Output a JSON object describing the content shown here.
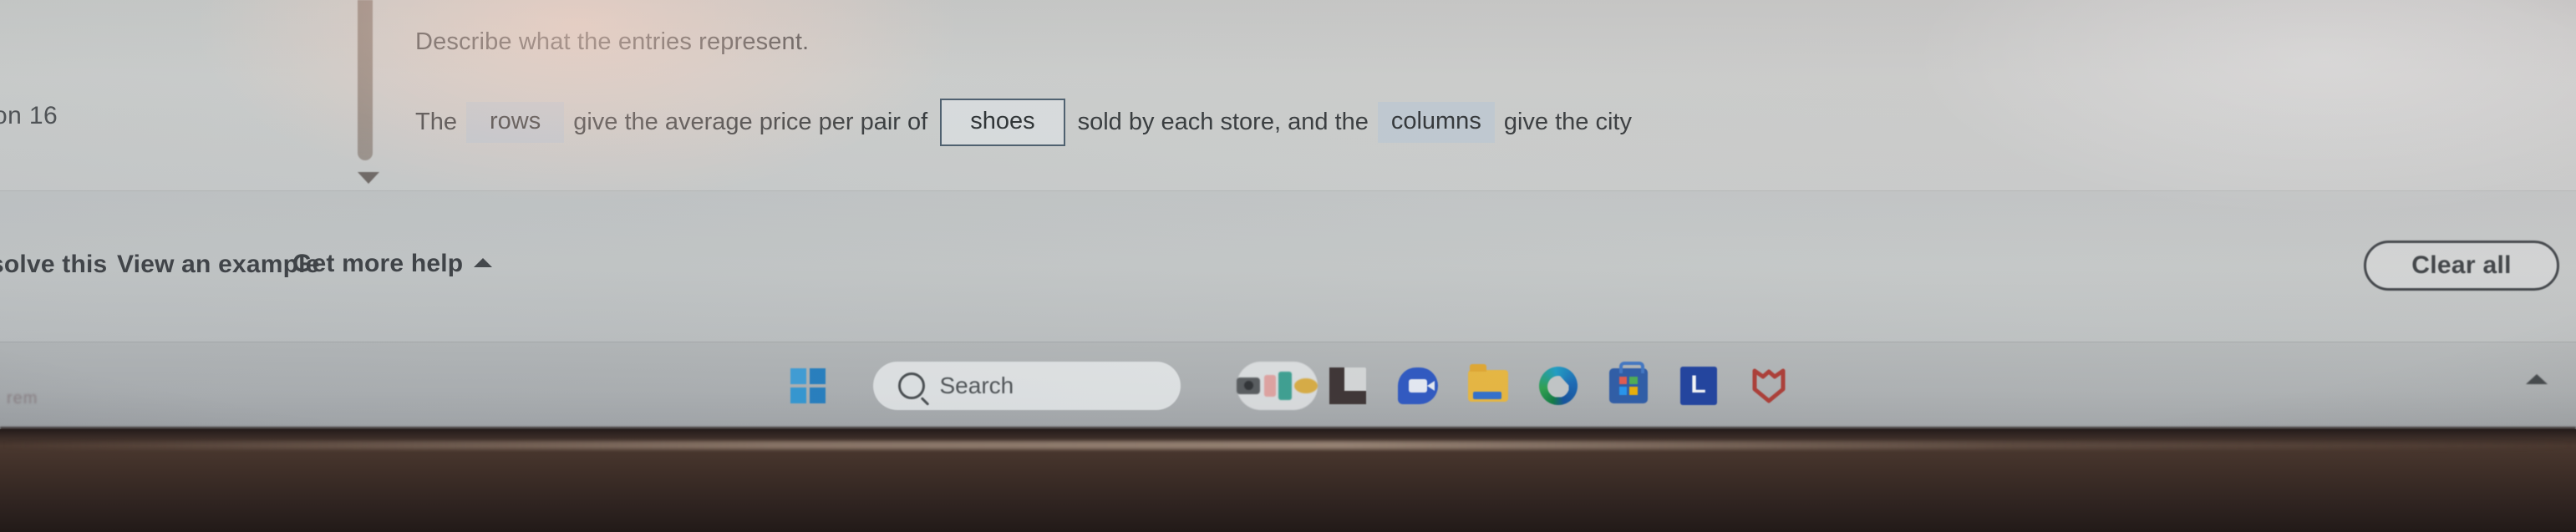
{
  "question": {
    "label": "on 16",
    "prompt": "Describe what the entries represent.",
    "sentence": {
      "lead": "The",
      "dropdown_1": "rows",
      "mid_1": "give the average price per pair of",
      "textbox_1": "shoes",
      "mid_2": "sold by each store, and the",
      "dropdown_2": "columns",
      "tail": "give the city"
    }
  },
  "toolbar": {
    "help_me_solve": "solve this",
    "view_example": "View an example",
    "get_more_help": "Get more help",
    "get_more_help_caret": "caret-up-icon",
    "clear_all": "Clear all"
  },
  "scrollbar": {
    "thumb": "scrollbar-thumb",
    "down_caret": "caret-down-icon"
  },
  "taskbar": {
    "start": "windows-start-icon",
    "search_placeholder": "Search",
    "search_icon": "search-icon",
    "items": [
      {
        "name": "widgets-icon",
        "label": "Widgets"
      },
      {
        "name": "app-dark-l-icon",
        "label": "App"
      },
      {
        "name": "zoom-icon",
        "label": "Zoom"
      },
      {
        "name": "file-explorer-icon",
        "label": "File Explorer"
      },
      {
        "name": "microsoft-edge-icon",
        "label": "Microsoft Edge"
      },
      {
        "name": "microsoft-store-icon",
        "label": "Microsoft Store"
      },
      {
        "name": "app-blue-l-icon",
        "label": "L"
      },
      {
        "name": "shield-red-icon",
        "label": "Security"
      }
    ],
    "blue_l_letter": "L",
    "tray_caret": "caret-up-icon",
    "faint_text": "rem"
  },
  "colors": {
    "screen_bg": "#c8cac8",
    "taskbar_bg": "#b2b5b6",
    "dropdown_fill": "#c2ccd4",
    "textbox_border": "#4c5e6e",
    "text": "#34383a",
    "bezel": "#4a382f",
    "start_blue": "#2f9ede",
    "edge_blue": "#1668b8",
    "folder_yellow": "#f0bb3c",
    "shield_red": "#b03a32",
    "blue_l": "#1c3fa0"
  }
}
